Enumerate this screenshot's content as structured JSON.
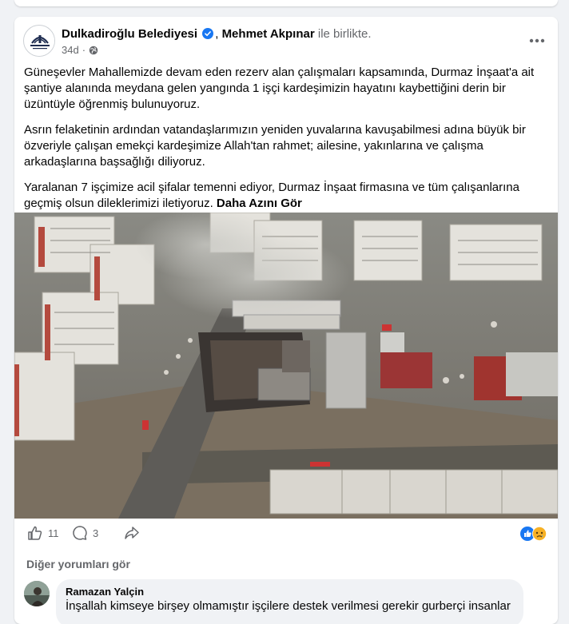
{
  "post": {
    "page_name": "Dulkadiroğlu Belediyesi",
    "tagged_name": "Mehmet Akpınar",
    "with_text": "ile birlikte.",
    "time": "34d",
    "separator": "·",
    "paragraphs": [
      "Güneşevler Mahallemizde devam eden rezerv alan çalışmaları kapsamında, Durmaz İnşaat'a ait şantiye alanında meydana gelen yangında 1 işçi kardeşimizin hayatını kaybettiğini derin bir üzüntüyle öğrenmiş bulunuyoruz.",
      "Asrın felaketinin ardından vatandaşlarımızın yeniden yuvalarına kavuşabilmesi adına büyük bir özveriyle çalışan emekçi kardeşimize Allah'tan rahmet; ailesine, yakınlarına ve çalışma arkadaşlarına başsağlığı diliyoruz."
    ],
    "last_paragraph": "Yaralanan 7 işçimize acil şifalar temenni ediyor, Durmaz İnşaat firmasına ve tüm çalışanlarına geçmiş olsun dileklerimizi iletiyoruz.",
    "see_more": "Daha Azını Gör",
    "logo_text": "DULKADİROĞLU BELEDİYESİ"
  },
  "stats": {
    "likes": "11",
    "comments": "3"
  },
  "comments_section": {
    "other_comments": "Diğer yorumları gör",
    "items": [
      {
        "name": "Ramazan Yalçin",
        "text": "İnşallah kimseye birşey olmamıştır işçilere destek verilmesi gerekir gurberçi insanlar"
      }
    ]
  },
  "colors": {
    "verified": "#1877f2",
    "like": "#1877f2",
    "sad": "#f7b125"
  },
  "icons": [
    "verified-icon",
    "globe-icon",
    "more-icon",
    "like-icon",
    "comment-icon",
    "share-icon",
    "like-reaction-icon",
    "sad-reaction-icon"
  ]
}
